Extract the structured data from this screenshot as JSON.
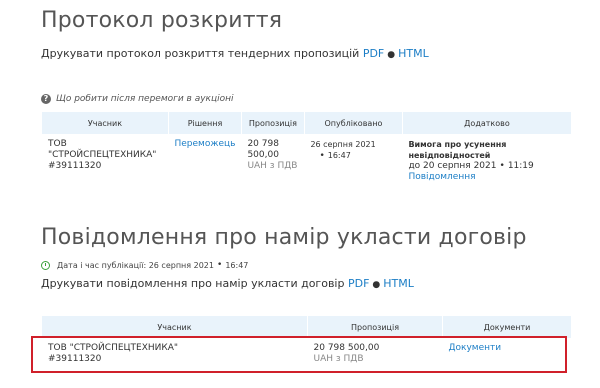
{
  "section1": {
    "title": "Протокол розкриття",
    "print_text": "Друкувати протокол розкриття тендерних пропозицій",
    "pdf": "PDF",
    "html": "HTML",
    "help_text": "Що робити після перемоги в аукціоні",
    "columns": [
      "Учасник",
      "Рішення",
      "Пропозиція",
      "Опубліковано",
      "Додатково"
    ],
    "row": {
      "participant_line1": "ТОВ",
      "participant_line2": "\"СТРОЙСПЕЦТЕХНИКА\"",
      "participant_line3": "#39111320",
      "decision": "Переможець",
      "offer_line1": "20 798",
      "offer_line2": "500,00",
      "offer_currency": "UAH з ПДВ",
      "published_date": "26 серпня 2021",
      "published_time": "16:47",
      "extra_title_line1": "Вимога про усунення",
      "extra_title_line2": "невідповідностей",
      "extra_due_date": "до 20 серпня 2021",
      "extra_due_time": "11:19",
      "extra_link": "Повідомлення"
    }
  },
  "section2": {
    "title": "Повідомлення про намір укласти договір",
    "pub_label": "Дата і час публікації: 26 серпня 2021",
    "pub_time": "16:47",
    "print_text": "Друкувати повідомлення про намір укласти договір",
    "pdf": "PDF",
    "html": "HTML",
    "columns": [
      "Учасник",
      "Пропозиція",
      "Документи"
    ],
    "row": {
      "participant_line1": "ТОВ \"СТРОЙСПЕЦТЕХНИКА\"",
      "participant_line2": "#39111320",
      "offer": "20 798 500,00",
      "offer_currency": "UAH з ПДВ",
      "documents_link": "Документи"
    }
  },
  "colors": {
    "link": "#1c7ec6",
    "header_bg": "#e9f3fb",
    "highlight": "#d0202a",
    "clock": "#3aa13a"
  }
}
